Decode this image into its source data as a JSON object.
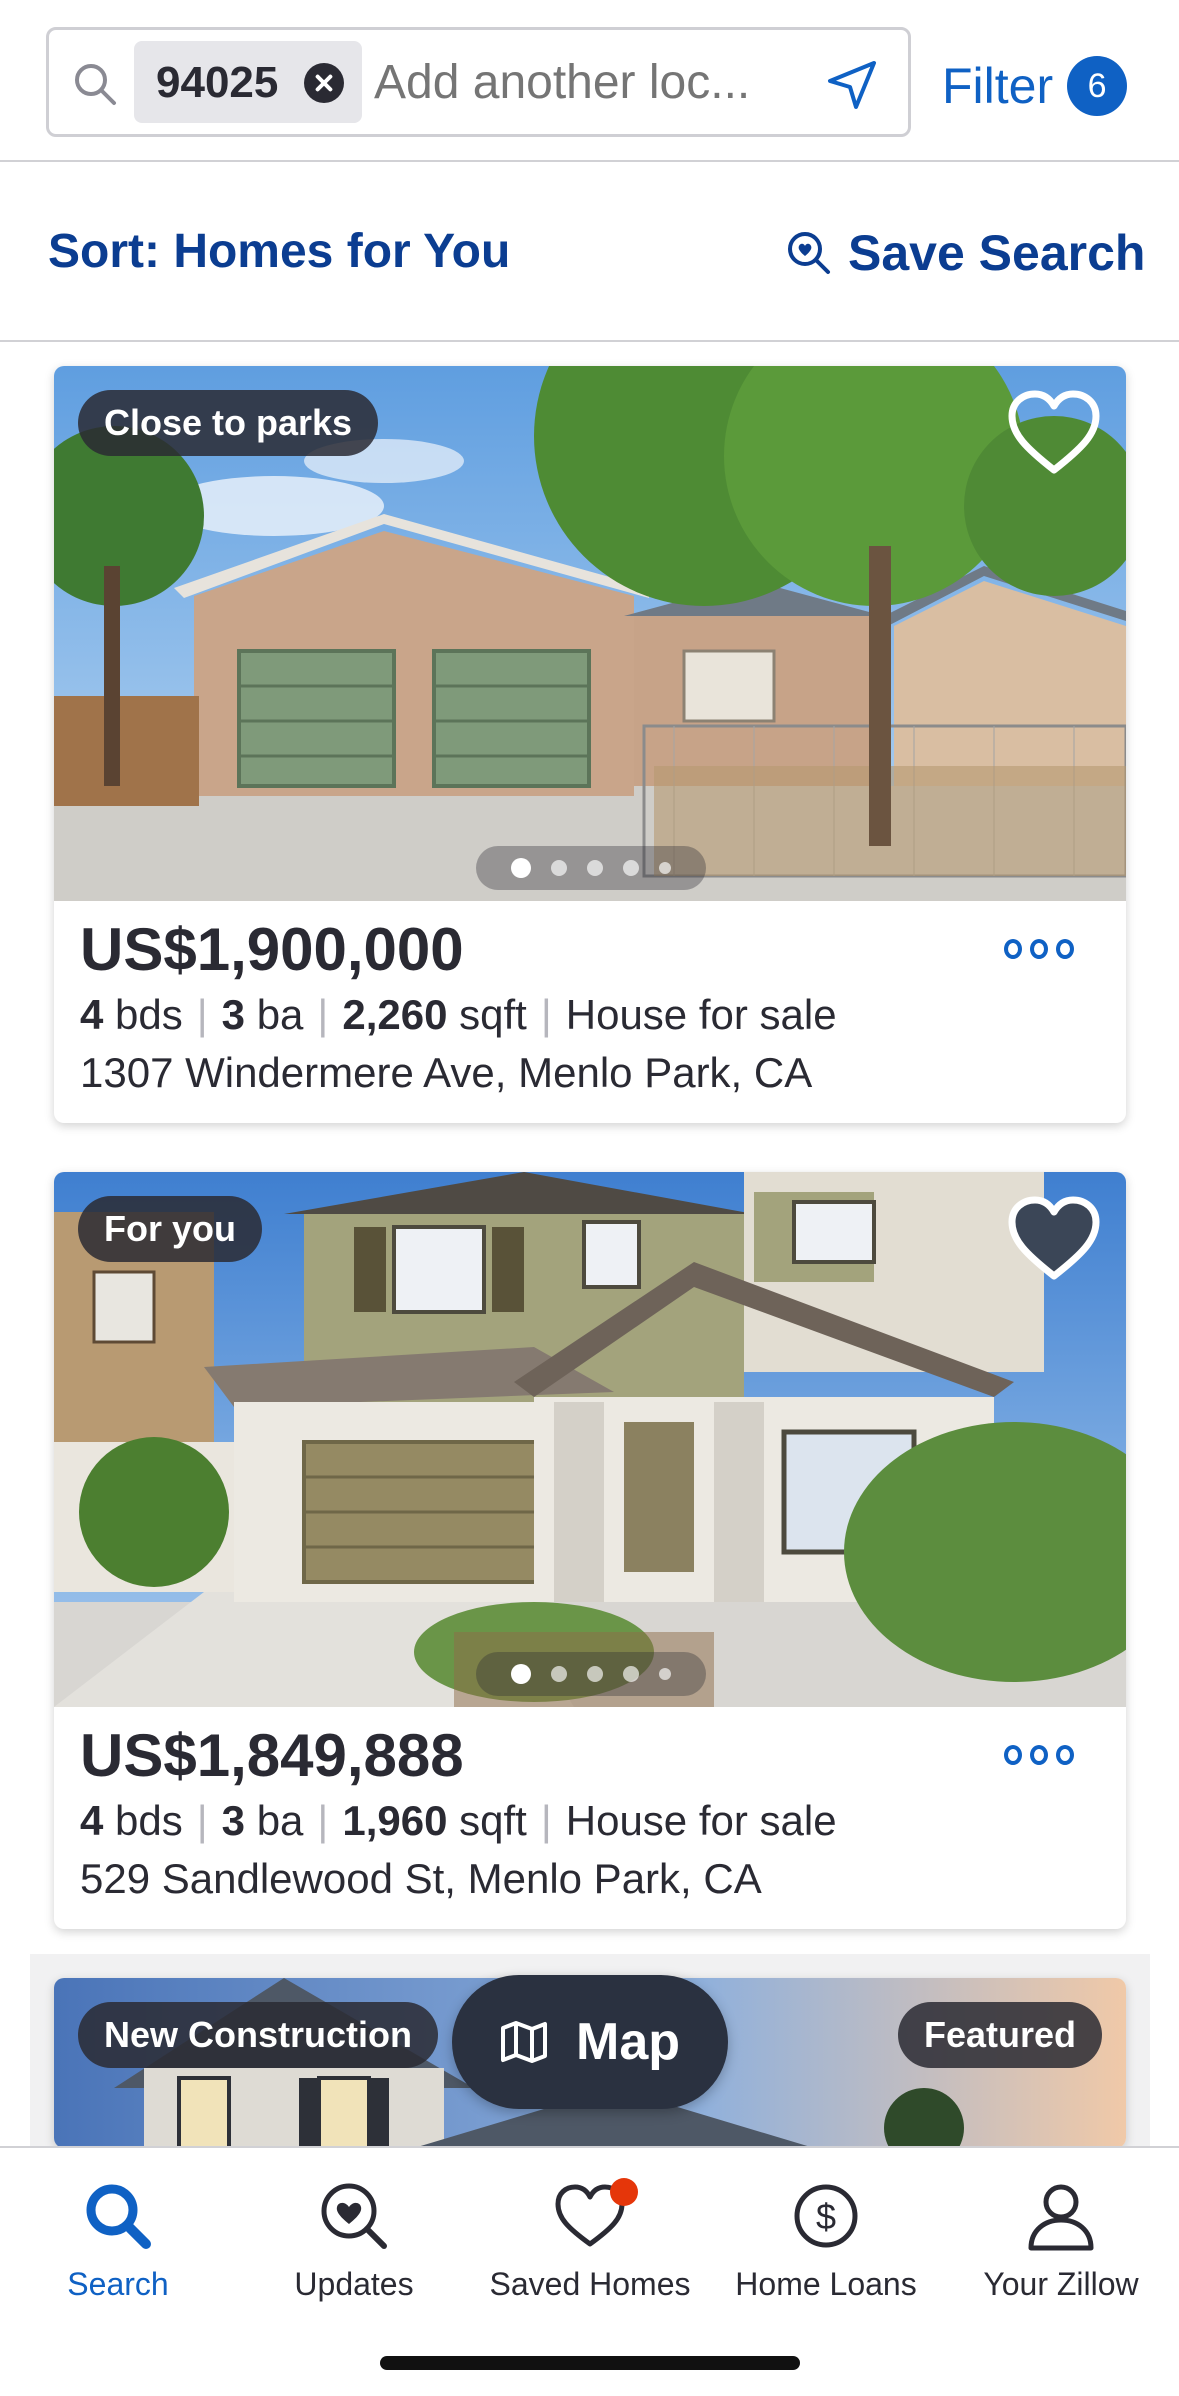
{
  "search": {
    "chip_value": "94025",
    "placeholder": "Add another loc...",
    "filter_label": "Filter",
    "filter_count": "6"
  },
  "sort": {
    "label": "Sort: Homes for You",
    "save_search_label": "Save Search"
  },
  "listings": [
    {
      "tag": "Close to parks",
      "price": "US$1,900,000",
      "beds": "4",
      "beds_unit": "bds",
      "baths": "3",
      "baths_unit": "ba",
      "sqft": "2,260",
      "sqft_unit": "sqft",
      "status": "House for sale",
      "address": "1307 Windermere Ave, Menlo Park, CA",
      "saved": false
    },
    {
      "tag": "For you",
      "price": "US$1,849,888",
      "beds": "4",
      "beds_unit": "bds",
      "baths": "3",
      "baths_unit": "ba",
      "sqft": "1,960",
      "sqft_unit": "sqft",
      "status": "House for sale",
      "address": "529 Sandlewood St, Menlo Park, CA",
      "saved": true
    },
    {
      "tag": "New Construction",
      "tag_right": "Featured"
    }
  ],
  "map_button": {
    "label": "Map"
  },
  "bottom_nav": [
    {
      "label": "Search",
      "icon": "search-icon",
      "active": true
    },
    {
      "label": "Updates",
      "icon": "updates-icon",
      "active": false
    },
    {
      "label": "Saved Homes",
      "icon": "heart-icon",
      "active": false,
      "badge": true
    },
    {
      "label": "Home Loans",
      "icon": "dollar-icon",
      "active": false
    },
    {
      "label": "Your Zillow",
      "icon": "person-icon",
      "active": false
    }
  ],
  "colors": {
    "brand_blue": "#0f61c4",
    "navy": "#0b3d91",
    "text": "#2a2a33",
    "badge_red": "#e5360a"
  }
}
